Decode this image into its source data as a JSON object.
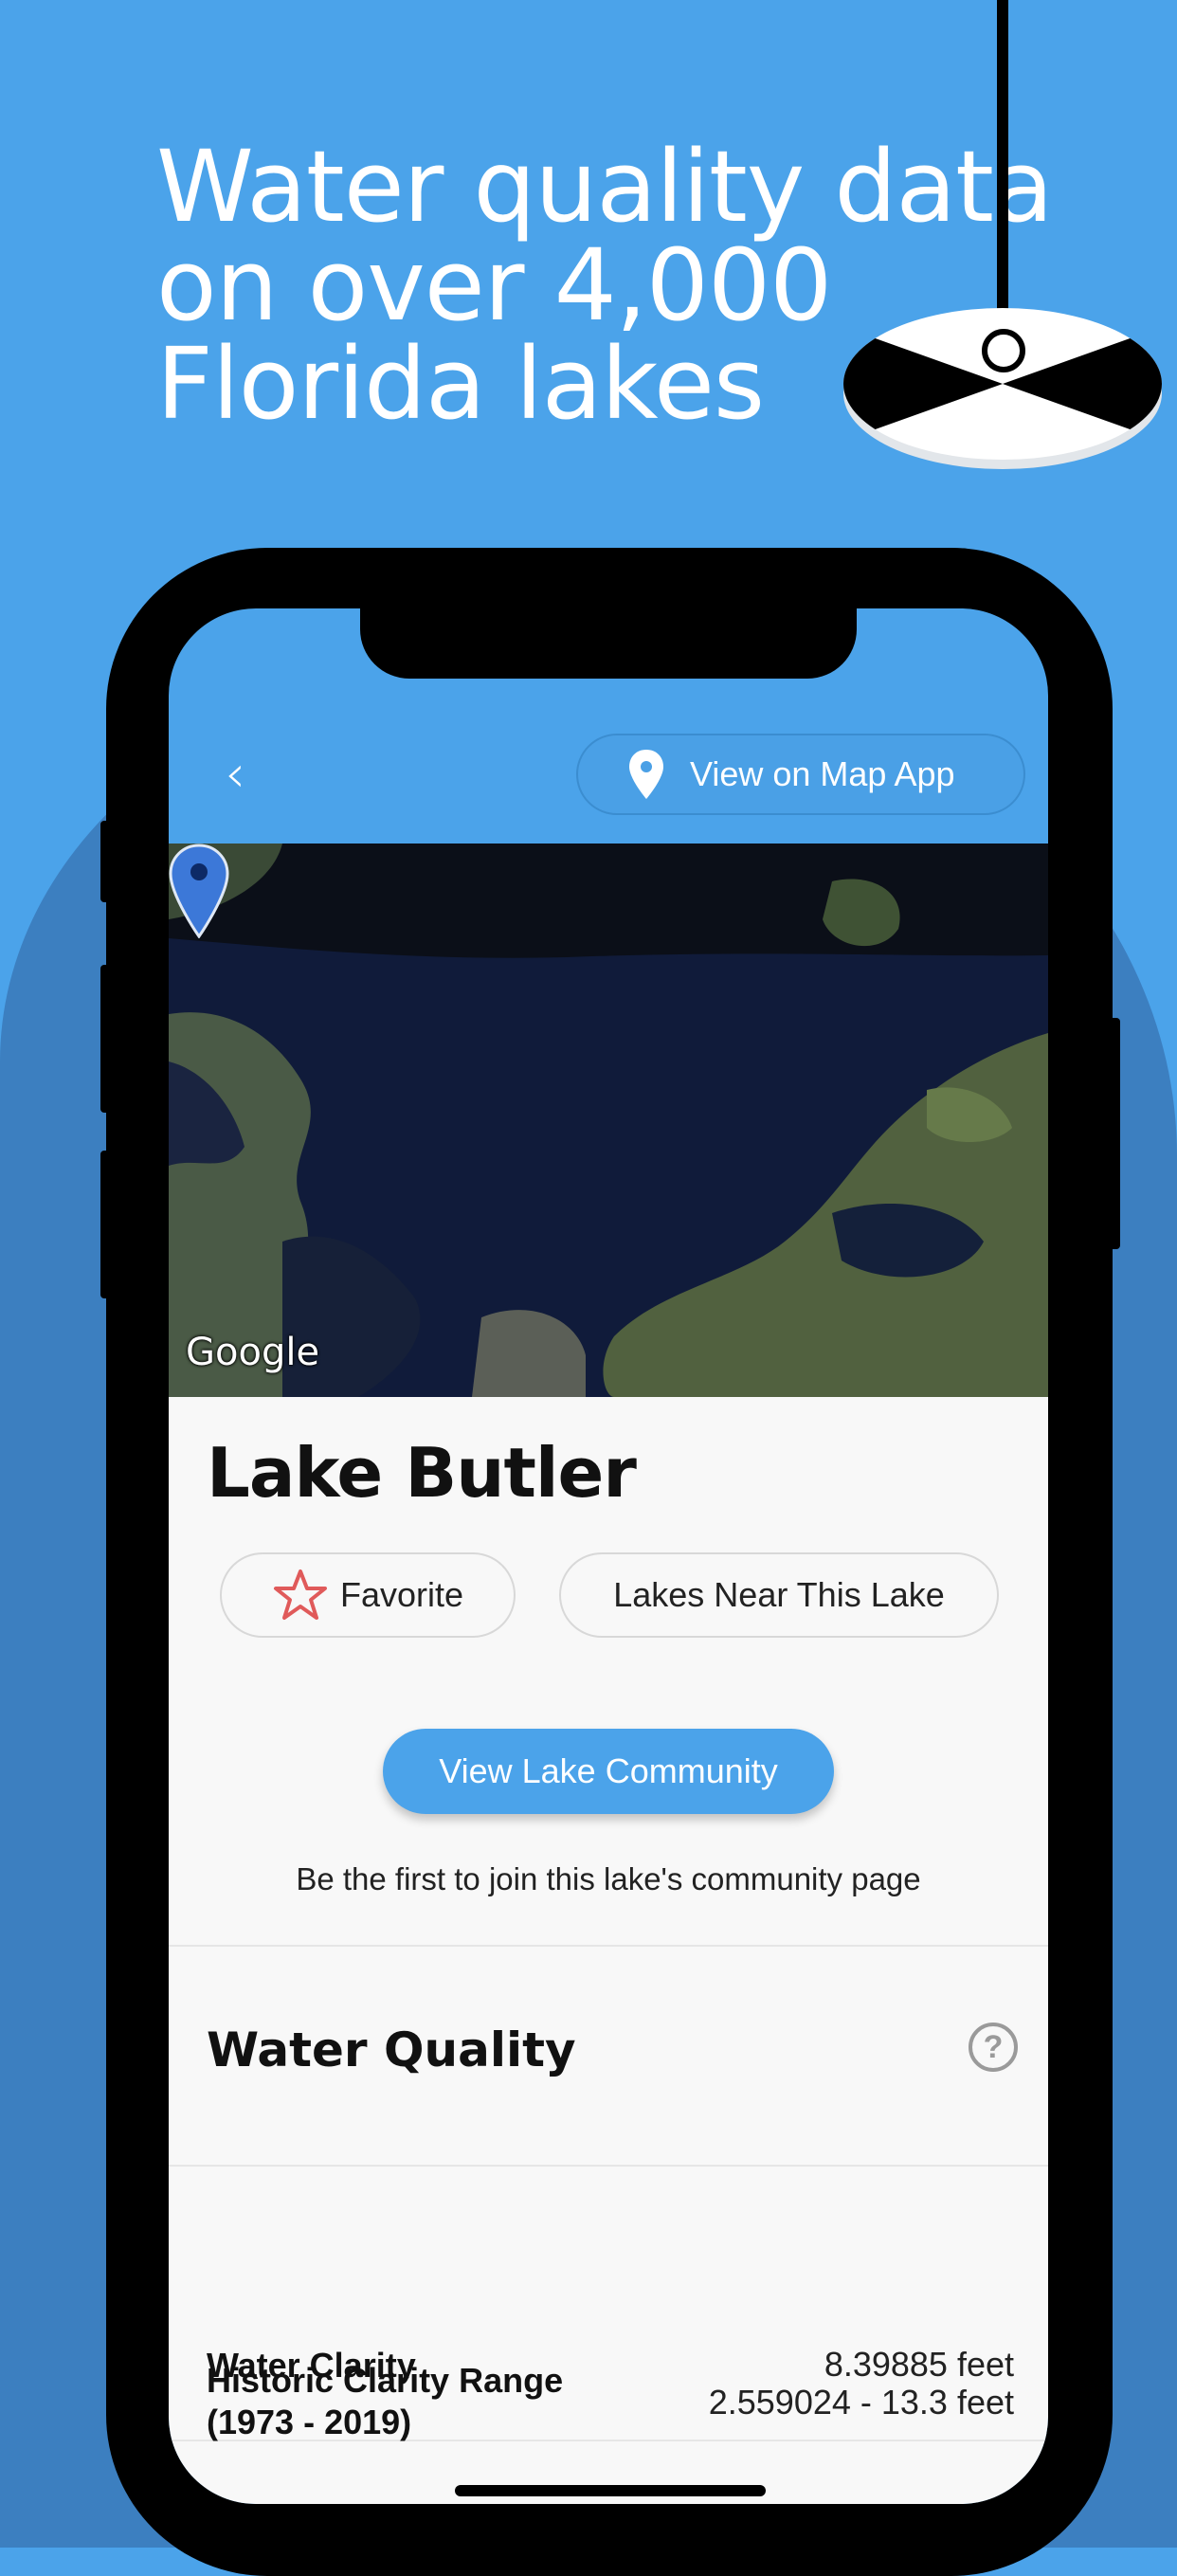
{
  "promo": {
    "headline_lines": [
      "Water quality data",
      "on over 4,000",
      "Florida lakes"
    ]
  },
  "app": {
    "header": {
      "back_icon": "chevron-left-icon",
      "map_button_label": "View on Map App",
      "map_button_icon": "location-pin-icon"
    },
    "map": {
      "attribution": "Google"
    },
    "lake": {
      "name": "Lake Butler",
      "favorite_label": "Favorite",
      "favorite_icon": "star-outline-icon",
      "nearby_label": "Lakes Near This Lake",
      "community_button_label": "View Lake Community",
      "community_note": "Be the first to join this lake's community page"
    },
    "water_quality": {
      "title": "Water Quality",
      "help_icon": "question-circle-icon",
      "help_glyph": "?",
      "rows": [
        {
          "label": "Water Clarity",
          "value": "8.39885 feet"
        },
        {
          "label_line1": "Historic Clarity Range",
          "label_line2": "(1973 - 2019)",
          "value": "2.559024 - 13.3 feet"
        }
      ]
    }
  },
  "colors": {
    "background": "#4ba3ea",
    "background_shape": "#3c7fc0",
    "accent": "#4ba3ea",
    "favorite_star": "#e05a5a",
    "map_water": "#0f1b38"
  }
}
